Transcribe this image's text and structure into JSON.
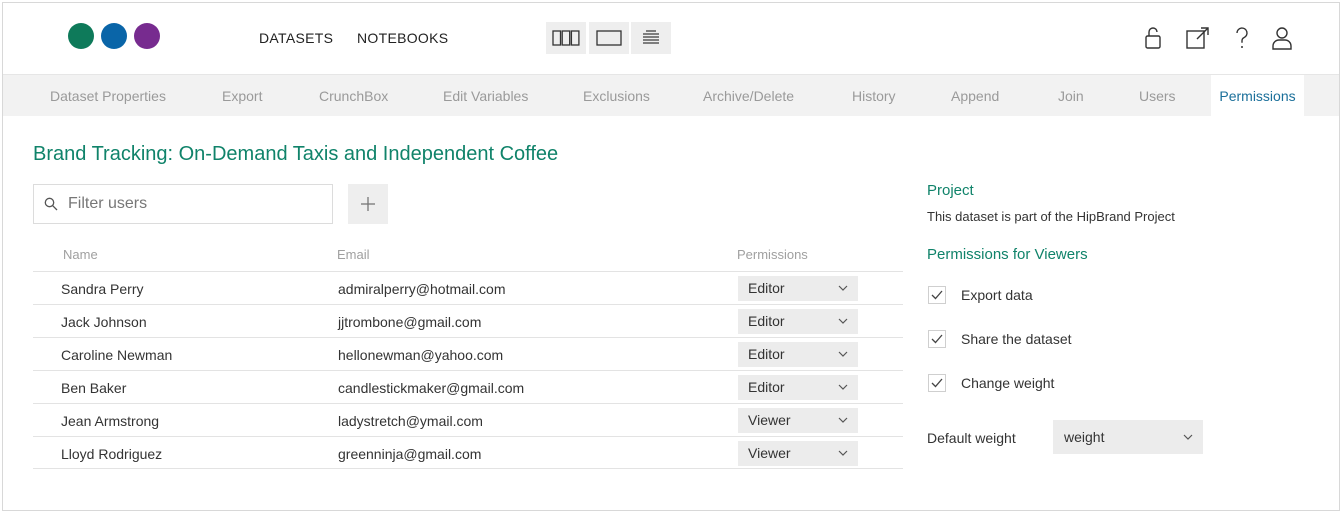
{
  "header": {
    "logo_dots": [
      {
        "name": "green",
        "color": "#0e7a5a"
      },
      {
        "name": "blue",
        "color": "#0a65a8"
      },
      {
        "name": "purple",
        "color": "#772b8f"
      }
    ],
    "nav": [
      "DATASETS",
      "NOTEBOOKS"
    ],
    "view_icons": [
      "three-column-view-icon",
      "single-panel-view-icon",
      "list-view-icon"
    ],
    "right_icons": [
      "lock-icon",
      "open-external-icon",
      "help-icon",
      "user-icon"
    ]
  },
  "tabs": [
    {
      "label": "Dataset Properties",
      "active": false
    },
    {
      "label": "Export",
      "active": false
    },
    {
      "label": "CrunchBox",
      "active": false
    },
    {
      "label": "Edit Variables",
      "active": false
    },
    {
      "label": "Exclusions",
      "active": false
    },
    {
      "label": "Archive/Delete",
      "active": false
    },
    {
      "label": "History",
      "active": false
    },
    {
      "label": "Append",
      "active": false
    },
    {
      "label": "Join",
      "active": false
    },
    {
      "label": "Users",
      "active": false
    },
    {
      "label": "Permissions",
      "active": true
    }
  ],
  "main": {
    "title": "Brand Tracking: On-Demand Taxis and Independent Coffee",
    "filter_placeholder": "Filter users",
    "add_label": "+",
    "columns": [
      "Name",
      "Email",
      "Permissions"
    ],
    "users": [
      {
        "name": "Sandra Perry",
        "email": "admiralperry@hotmail.com",
        "permission": "Editor"
      },
      {
        "name": "Jack Johnson",
        "email": "jjtrombone@gmail.com",
        "permission": "Editor"
      },
      {
        "name": "Caroline Newman",
        "email": "hellonewman@yahoo.com",
        "permission": "Editor"
      },
      {
        "name": "Ben Baker",
        "email": "candlestickmaker@gmail.com",
        "permission": "Editor"
      },
      {
        "name": "Jean Armstrong",
        "email": "ladystretch@ymail.com",
        "permission": "Viewer"
      },
      {
        "name": "Lloyd Rodriguez",
        "email": "greenninja@gmail.com",
        "permission": "Viewer"
      }
    ]
  },
  "sidebar": {
    "project_heading": "Project",
    "project_text": "This dataset is part of the HipBrand Project",
    "viewers_heading": "Permissions for Viewers",
    "options": [
      {
        "label": "Export data",
        "checked": true
      },
      {
        "label": "Share the dataset",
        "checked": true
      },
      {
        "label": "Change weight",
        "checked": true
      }
    ],
    "default_weight_label": "Default weight",
    "default_weight_value": "weight"
  },
  "colors": {
    "accent_green": "#10836a",
    "active_tab_blue": "#1a6f9a",
    "tab_bg": "#f2f2f2"
  }
}
